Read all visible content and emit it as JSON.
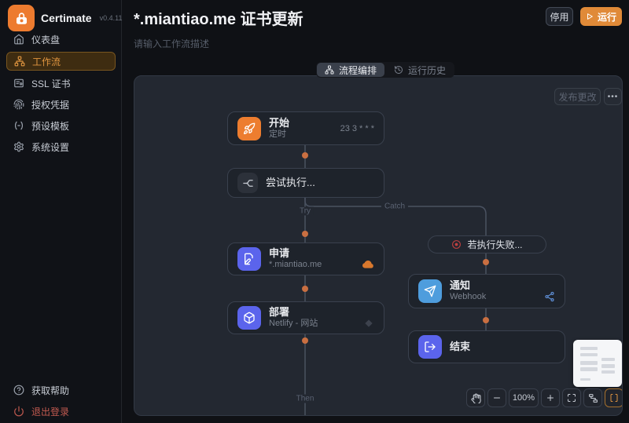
{
  "sidebar": {
    "brand": "Certimate",
    "version": "v0.4.11",
    "items": [
      {
        "label": "仪表盘"
      },
      {
        "label": "工作流"
      },
      {
        "label": "SSL 证书"
      },
      {
        "label": "授权凭据"
      },
      {
        "label": "预设模板"
      },
      {
        "label": "系统设置"
      }
    ],
    "footer_items": [
      {
        "label": "获取帮助"
      },
      {
        "label": "退出登录"
      }
    ]
  },
  "header": {
    "title": "*.miantiao.me 证书更新",
    "description_placeholder": "请输入工作流描述",
    "disable_button": "停用",
    "run_button": "运行"
  },
  "tabs": [
    {
      "label": "流程编排",
      "active": true
    },
    {
      "label": "运行历史",
      "active": false
    }
  ],
  "canvas": {
    "publish_button": "发布更改",
    "more_button": "•••",
    "branch_labels": {
      "try": "Try",
      "catch": "Catch",
      "then": "Then"
    },
    "nodes": {
      "start": {
        "title": "开始",
        "subtitle": "定时",
        "meta": "23 3 * * *",
        "icon": "rocket-icon",
        "icon_color": "#ed7d2f"
      },
      "try_block": {
        "title": "尝试执行...",
        "icon": "split-icon",
        "icon_color": "#2c313a"
      },
      "apply": {
        "title": "申请",
        "subtitle": "*.miantiao.me",
        "icon": "file-pen-icon",
        "icon_color": "#5b64ec",
        "provider_icon": "aliyun-cloud-icon"
      },
      "deploy": {
        "title": "部署",
        "subtitle": "Netlify - 网站",
        "icon": "package-icon",
        "icon_color": "#5b64ec",
        "provider_icon": "netlify-icon"
      },
      "on_failure": {
        "title": "若执行失败...",
        "icon": "alert-circle-icon",
        "icon_color": "#c14040"
      },
      "notify": {
        "title": "通知",
        "subtitle": "Webhook",
        "icon": "send-icon",
        "icon_color": "#4e9ddd",
        "provider_icon": "webhook-icon"
      },
      "end": {
        "title": "结束",
        "icon": "log-out-icon",
        "icon_color": "#5b64ec"
      }
    },
    "toolbar": {
      "zoom_level": "100%"
    }
  },
  "colors": {
    "accent_orange": "#e08a38",
    "logo_orange": "#ed7b2f",
    "connector_dot": "#c96f41",
    "connector_line": "#4a5261",
    "canvas_bg": "#232831",
    "node_bg": "#1e232b",
    "danger_red": "#c25a50",
    "indigo_node": "#5b64ec",
    "blue_node": "#4e9ddd"
  }
}
